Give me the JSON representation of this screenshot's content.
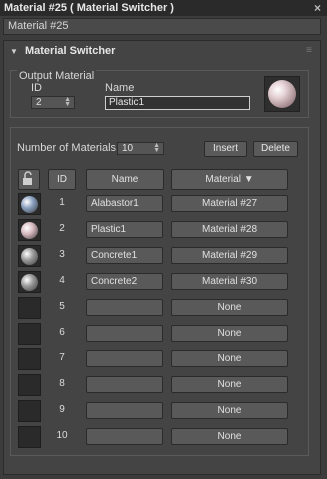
{
  "window": {
    "title": "Material #25  ( Material Switcher )",
    "close_glyph": "×"
  },
  "material_name": "Material #25",
  "rollout": {
    "title": "Material Switcher"
  },
  "output": {
    "group_label": "Output Material",
    "id_label": "ID",
    "id_value": "2",
    "name_label": "Name",
    "name_value": "Plastic1"
  },
  "controls": {
    "num_label": "Number of Materials",
    "num_value": "10",
    "insert_label": "Insert",
    "delete_label": "Delete"
  },
  "table": {
    "headers": {
      "id": "ID",
      "name": "Name",
      "material": "Material ▼"
    },
    "rows": [
      {
        "id": "1",
        "name": "Alabastor1",
        "material": "Material #27",
        "swatch": "blue"
      },
      {
        "id": "2",
        "name": "Plastic1",
        "material": "Material #28",
        "swatch": "pink"
      },
      {
        "id": "3",
        "name": "Concrete1",
        "material": "Material #29",
        "swatch": "gray"
      },
      {
        "id": "4",
        "name": "Concrete2",
        "material": "Material #30",
        "swatch": "gray"
      },
      {
        "id": "5",
        "name": "",
        "material": "None",
        "swatch": ""
      },
      {
        "id": "6",
        "name": "",
        "material": "None",
        "swatch": ""
      },
      {
        "id": "7",
        "name": "",
        "material": "None",
        "swatch": ""
      },
      {
        "id": "8",
        "name": "",
        "material": "None",
        "swatch": ""
      },
      {
        "id": "9",
        "name": "",
        "material": "None",
        "swatch": ""
      },
      {
        "id": "10",
        "name": "",
        "material": "None",
        "swatch": ""
      }
    ]
  },
  "colors": {
    "blue": "#8aa0c0",
    "pink": "#d7b8bf",
    "gray": "#9a9a9a"
  }
}
